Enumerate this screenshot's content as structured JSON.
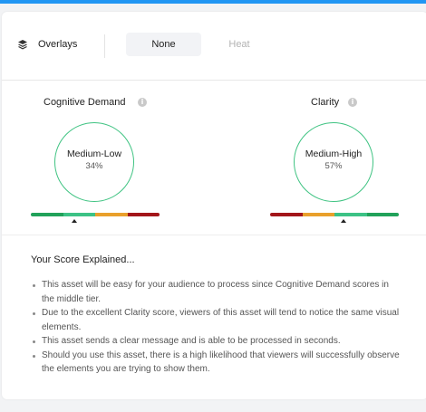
{
  "toolbar": {
    "overlays_label": "Overlays",
    "option_none": "None",
    "option_heat": "Heat",
    "selected": "None"
  },
  "metrics": [
    {
      "title": "Cognitive Demand",
      "level": "Medium-Low",
      "score": "34%",
      "info_glyph": "i",
      "bar_colors": [
        "#21a25a",
        "#3cc285",
        "#e9a02b",
        "#a3161a"
      ],
      "marker_position": 0.34
    },
    {
      "title": "Clarity",
      "level": "Medium-High",
      "score": "57%",
      "info_glyph": "i",
      "bar_colors": [
        "#a3161a",
        "#e9a02b",
        "#3cc285",
        "#21a25a"
      ],
      "marker_position": 0.57
    }
  ],
  "explanation": {
    "title": "Your Score Explained...",
    "bullets": [
      "This asset will be easy for your audience to process since Cognitive Demand scores in the middle tier.",
      "Due to the excellent Clarity score, viewers of this asset will tend to notice the same visual elements.",
      "This asset sends a clear message and is able to be processed in seconds.",
      "Should you use this asset, there is a high likelihood that viewers will successfully observe the elements you are trying to show them."
    ]
  },
  "colors": {
    "accent": "#2196f3",
    "ring": "#3fc382"
  },
  "icons": {
    "overlays": "layers-icon",
    "info": "info-icon"
  }
}
